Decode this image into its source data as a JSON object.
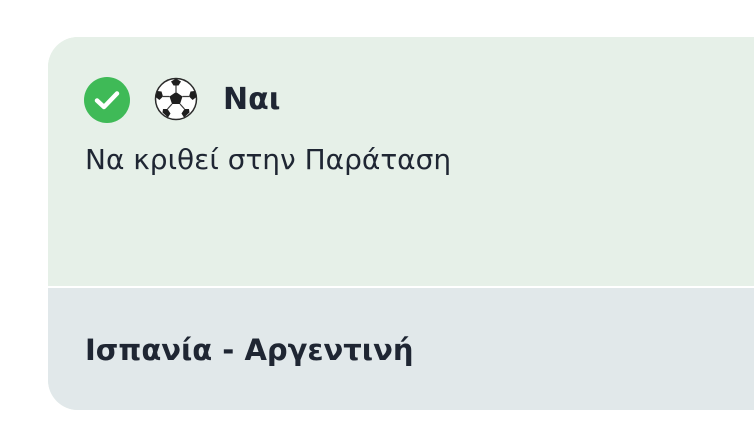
{
  "bet": {
    "status_icon": "check-circle-icon",
    "sport_icon": "soccer-ball-icon",
    "selection": "Ναι",
    "market": "Να κριθεί στην Παράταση",
    "event": "Ισπανία - Αργεντινή"
  },
  "colors": {
    "card_top": "#e6f0e8",
    "card_bottom": "#e1e8ea",
    "check": "#3fba57",
    "text": "#1f2633"
  }
}
